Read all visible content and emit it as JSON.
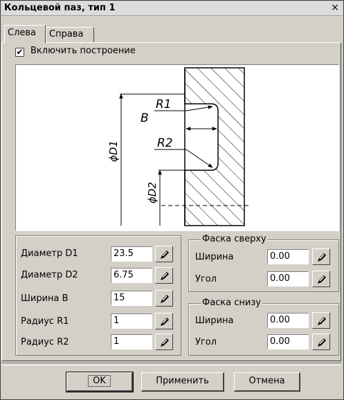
{
  "window": {
    "title": "Кольцевой паз, тип 1",
    "close_glyph": "×"
  },
  "tabs": [
    {
      "label": "Слева"
    },
    {
      "label": "Справа"
    }
  ],
  "enable_build": {
    "label": "Включить построение",
    "checked": true,
    "check_glyph": "✔"
  },
  "drawing": {
    "labels": {
      "r1": "R1",
      "b": "B",
      "r2": "R2",
      "d1": "ϕD1",
      "d2": "ϕD2"
    }
  },
  "dimensions": {
    "diameter_d1": {
      "label": "Диаметр D1",
      "value": "23.5"
    },
    "diameter_d2": {
      "label": "Диаметр D2",
      "value": "6.75"
    },
    "width_b": {
      "label": "Ширина B",
      "value": "15"
    },
    "radius_r1": {
      "label": "Радиус R1",
      "value": "1"
    },
    "radius_r2": {
      "label": "Радиус R2",
      "value": "1"
    }
  },
  "chamfer_top": {
    "title": "Фаска сверху",
    "width": {
      "label": "Ширина",
      "value": "0.00"
    },
    "angle": {
      "label": "Угол",
      "value": "0.00"
    }
  },
  "chamfer_bottom": {
    "title": "Фаска снизу",
    "width": {
      "label": "Ширина",
      "value": "0.00"
    },
    "angle": {
      "label": "Угол",
      "value": "0.00"
    }
  },
  "buttons": {
    "ok": "OK",
    "apply": "Применить",
    "cancel": "Отмена"
  }
}
